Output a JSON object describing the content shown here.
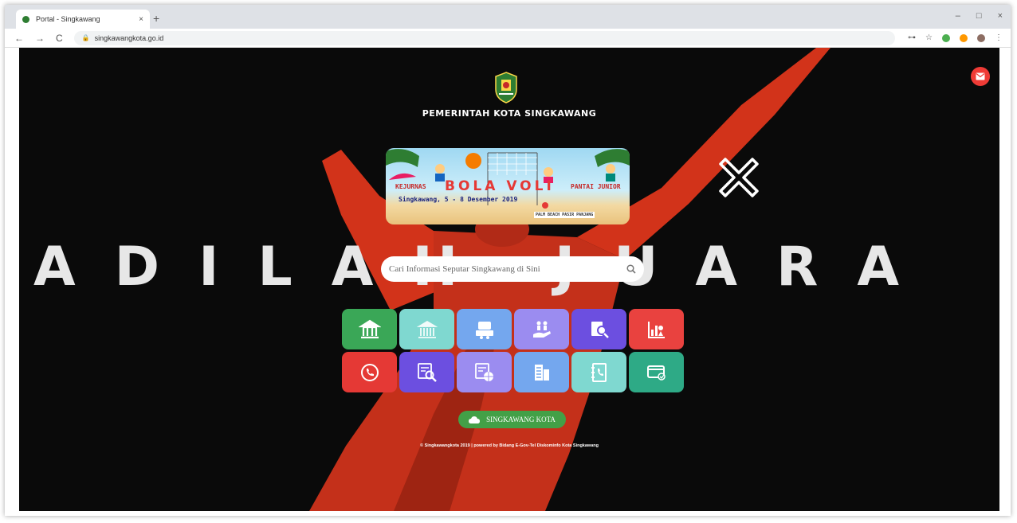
{
  "browser": {
    "tab_title": "Portal - Singkawang",
    "tab_close": "×",
    "new_tab": "+",
    "url": "singkawangkota.go.id",
    "nav_back": "←",
    "nav_forward": "→",
    "nav_reload": "C",
    "lock_glyph": "🔒",
    "win_min": "–",
    "win_max": "□",
    "win_close": "×",
    "key_glyph": "⊶",
    "star_glyph": "☆",
    "menu_glyph": "⋮"
  },
  "page": {
    "header_title": "PEMERINTAH KOTA SINGKAWANG",
    "background_slogan": "ADILAH JUARA !!",
    "banner": {
      "left_word": "KEJURNAS",
      "main_word": "BOLA VOLI",
      "right_word": "PANTAI JUNIOR",
      "date_line": "Singkawang, 5 - 8 Desember 2019",
      "venue": "PALM BEACH PASIR PANJANG"
    },
    "search": {
      "placeholder": "Cari Informasi Seputar Singkawang di Sini",
      "icon": "search-icon"
    },
    "tiles": [
      {
        "name": "government-icon",
        "color": "#3aa757"
      },
      {
        "name": "building-icon",
        "color": "#7fd8d0"
      },
      {
        "name": "service-desk-icon",
        "color": "#74a7ee"
      },
      {
        "name": "helping-hand-icon",
        "color": "#9b8cf0"
      },
      {
        "name": "document-search-icon",
        "color": "#6c4fe0"
      },
      {
        "name": "statistics-icon",
        "color": "#e9423f"
      },
      {
        "name": "phone-call-icon",
        "color": "#e53935"
      },
      {
        "name": "web-search-icon",
        "color": "#6c4fe0"
      },
      {
        "name": "web-news-icon",
        "color": "#9b8cf0"
      },
      {
        "name": "office-building-icon",
        "color": "#74a7ee"
      },
      {
        "name": "contact-book-icon",
        "color": "#7fd8d0"
      },
      {
        "name": "payment-card-icon",
        "color": "#2eaa86"
      }
    ],
    "city_button_label": "SINGKAWANG KOTA",
    "footer": "© Singkawangkota 2019 | powered by Bidang E-Gov-Tel Diskominfo Kota Singkawang",
    "colors": {
      "background": "#0a0a0a",
      "figure_red": "#d2331a",
      "mail_button": "#ef3b36",
      "city_button": "#43a047"
    }
  }
}
